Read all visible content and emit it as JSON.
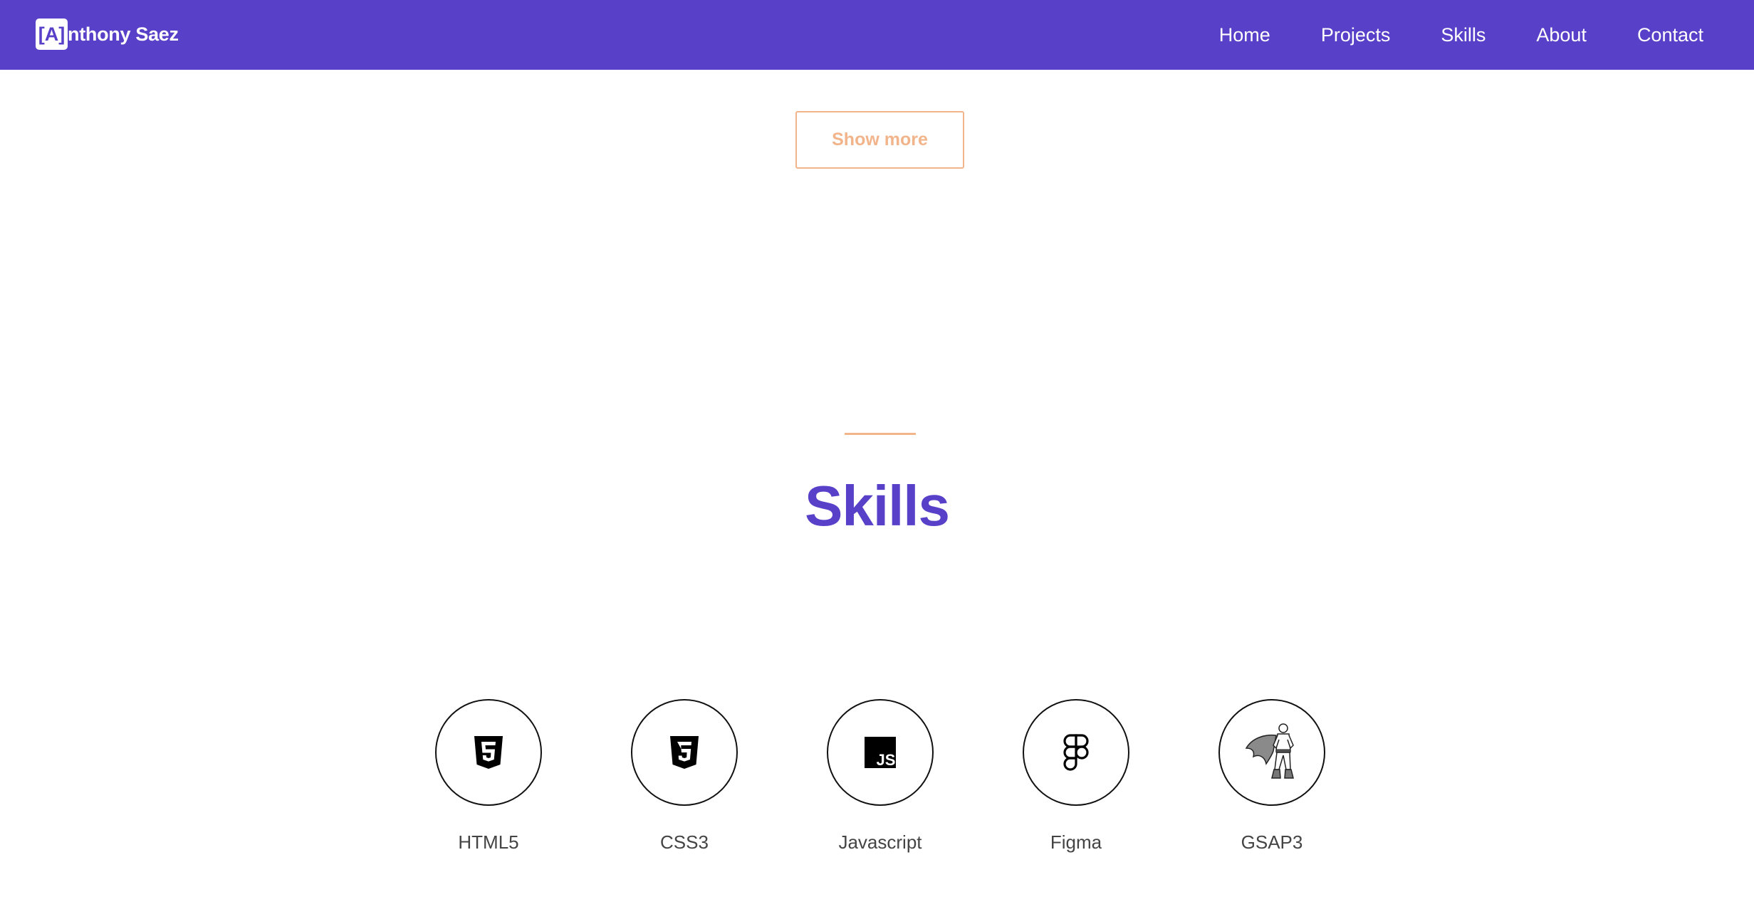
{
  "header": {
    "brand_box": "[A]",
    "brand_rest": "nthony Saez",
    "nav": [
      "Home",
      "Projects",
      "Skills",
      "About",
      "Contact"
    ]
  },
  "projects": {
    "show_more_label": "Show more"
  },
  "skills": {
    "title": "Skills",
    "items": [
      {
        "label": "HTML5",
        "icon": "html5-icon"
      },
      {
        "label": "CSS3",
        "icon": "css3-icon"
      },
      {
        "label": "Javascript",
        "icon": "javascript-icon"
      },
      {
        "label": "Figma",
        "icon": "figma-icon"
      },
      {
        "label": "GSAP3",
        "icon": "gsap-superhero-icon"
      }
    ]
  },
  "colors": {
    "primary": "#5940c8",
    "accent": "#f2b48a",
    "text": "#444444"
  }
}
